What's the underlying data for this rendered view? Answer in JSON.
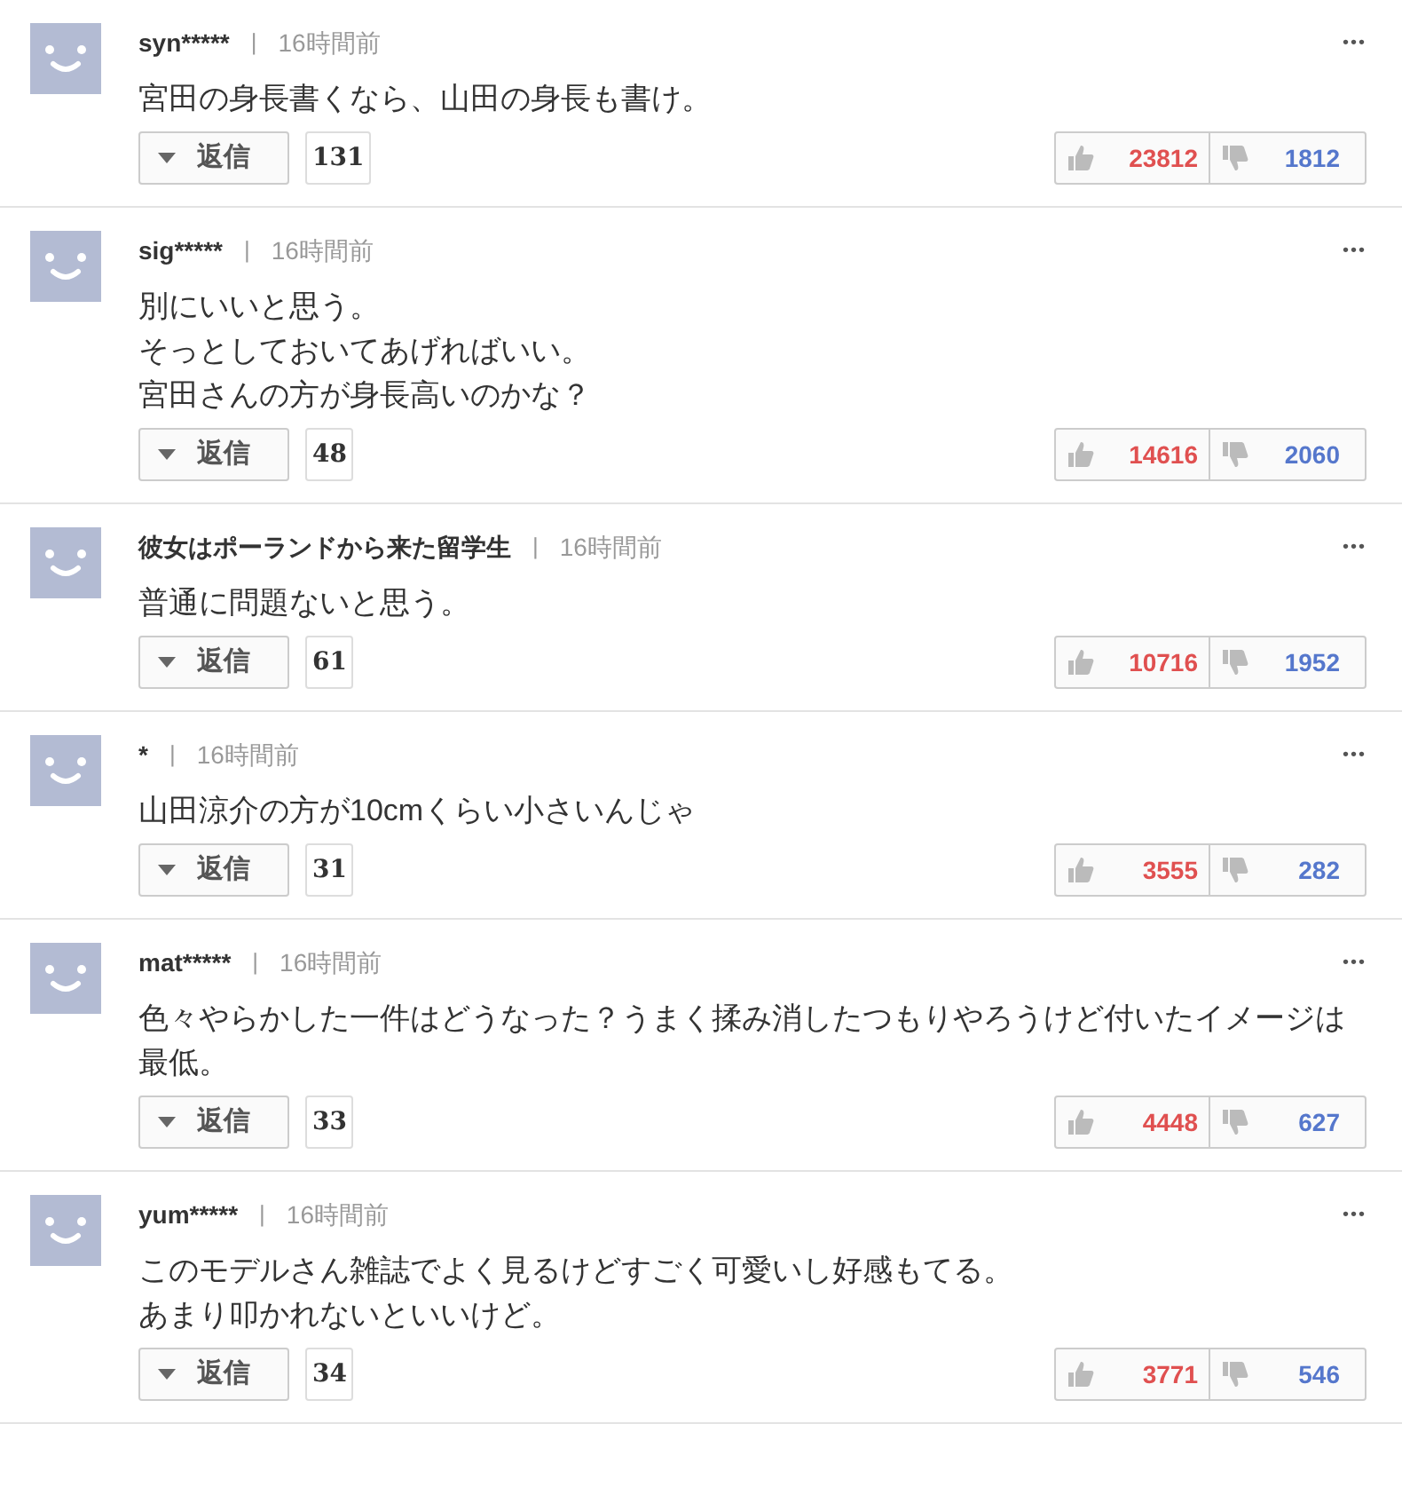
{
  "comments": [
    {
      "user": "syn*****",
      "separator": "|",
      "time": "16時間前",
      "more": "•••",
      "lines": [
        "宮田の身長書くなら、山田の身長も書け。"
      ],
      "reply": "返信",
      "reply_count": "131",
      "likes": "23812",
      "dislikes": "1812"
    },
    {
      "user": "sig*****",
      "separator": "|",
      "time": "16時間前",
      "more": "•••",
      "lines": [
        "別にいいと思う。",
        "そっとしておいてあげればいい。",
        "宮田さんの方が身長高いのかな？"
      ],
      "reply": "返信",
      "reply_count": "48",
      "likes": "14616",
      "dislikes": "2060"
    },
    {
      "user": "彼女はポーランドから来た留学生",
      "separator": "|",
      "time": "16時間前",
      "more": "•••",
      "lines": [
        "普通に問題ないと思う。"
      ],
      "reply": "返信",
      "reply_count": "61",
      "likes": "10716",
      "dislikes": "1952"
    },
    {
      "user": "*",
      "separator": "|",
      "time": "16時間前",
      "more": "•••",
      "lines": [
        "山田涼介の方が10cmくらい小さいんじゃ"
      ],
      "reply": "返信",
      "reply_count": "31",
      "likes": "3555",
      "dislikes": "282"
    },
    {
      "user": "mat*****",
      "separator": "|",
      "time": "16時間前",
      "more": "•••",
      "lines": [
        "色々やらかした一件はどうなった？うまく揉み消したつもりやろうけど付いたイメージは最低。"
      ],
      "reply": "返信",
      "reply_count": "33",
      "likes": "4448",
      "dislikes": "627"
    },
    {
      "user": "yum*****",
      "separator": "|",
      "time": "16時間前",
      "more": "•••",
      "lines": [
        "このモデルさん雑誌でよく見るけどすごく可愛いし好感もてる。",
        "あまり叩かれないといいけど。"
      ],
      "reply": "返信",
      "reply_count": "34",
      "likes": "3771",
      "dislikes": "546"
    }
  ]
}
